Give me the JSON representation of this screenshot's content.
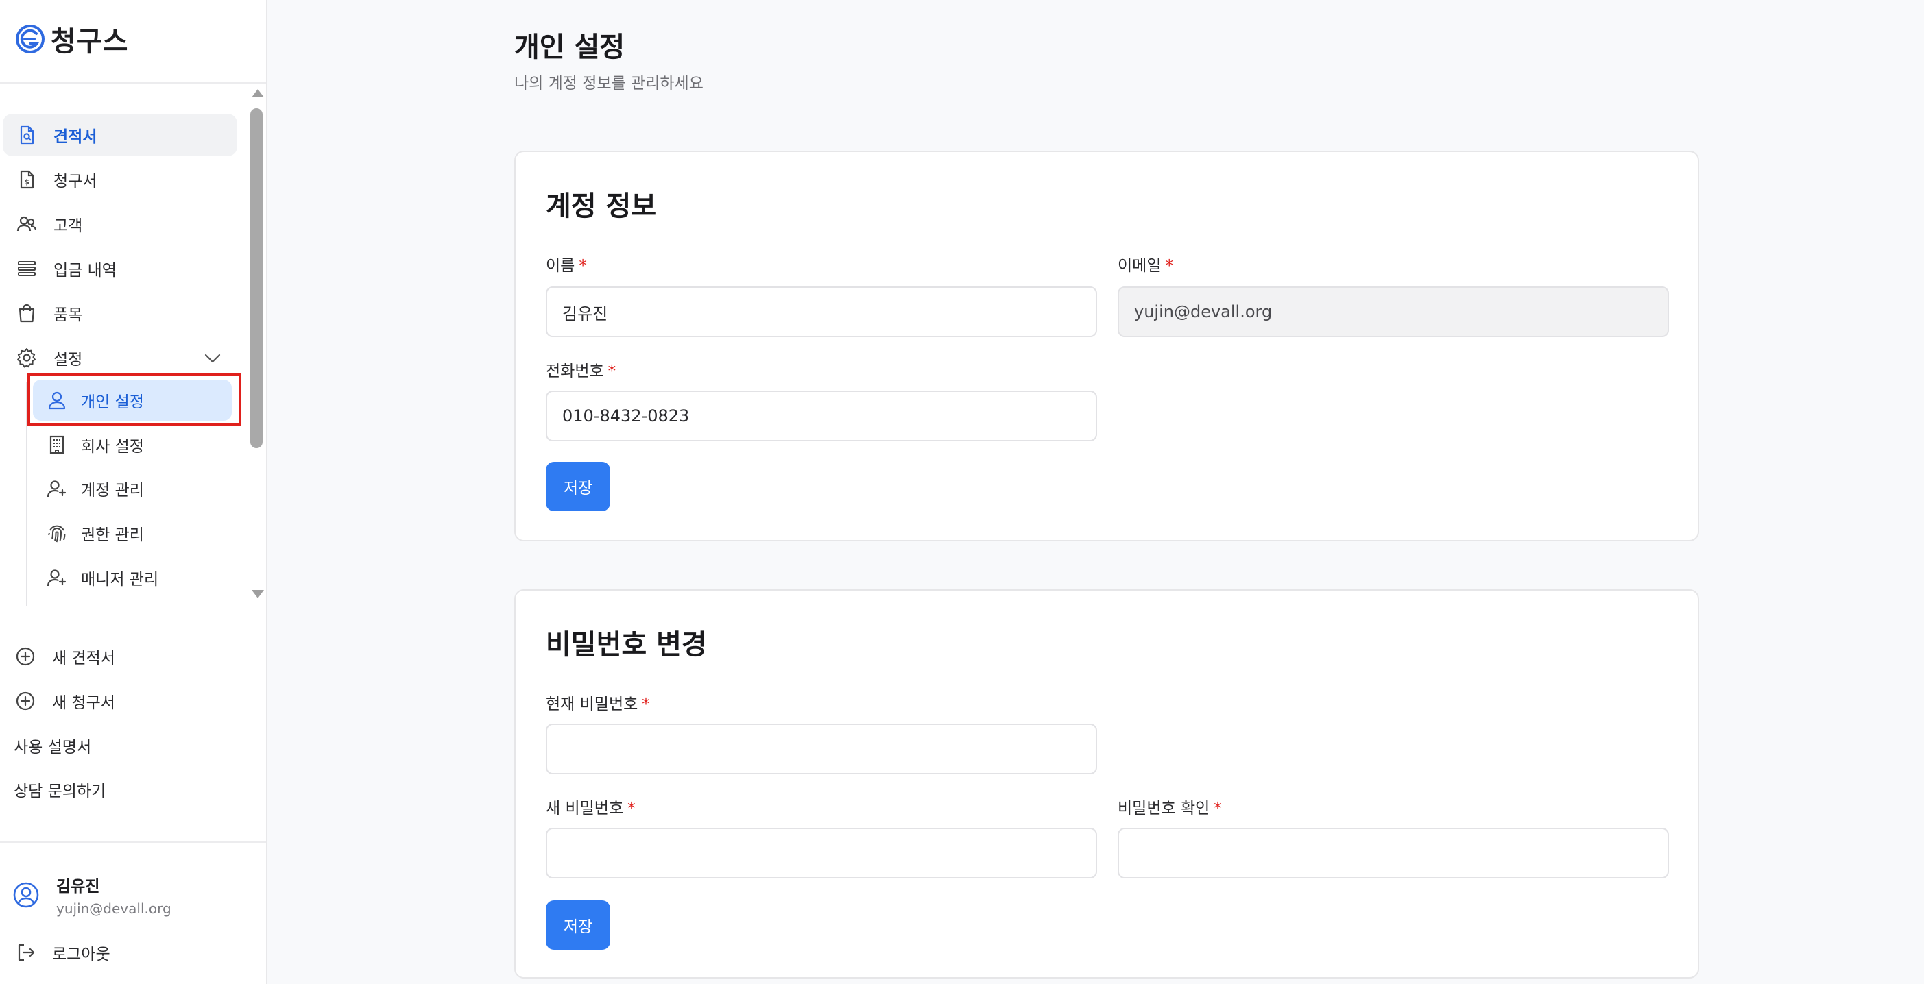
{
  "app": {
    "name": "청구스"
  },
  "sidebar": {
    "nav": [
      {
        "label": "견적서",
        "icon": "quote-doc-icon"
      },
      {
        "label": "청구서",
        "icon": "invoice-doc-icon"
      },
      {
        "label": "고객",
        "icon": "customers-icon"
      },
      {
        "label": "입금 내역",
        "icon": "list-icon"
      },
      {
        "label": "품목",
        "icon": "shopping-bag-icon"
      },
      {
        "label": "설정",
        "icon": "gear-icon"
      }
    ],
    "settings_sub": [
      {
        "label": "개인 설정",
        "icon": "user-icon"
      },
      {
        "label": "회사 설정",
        "icon": "building-icon"
      },
      {
        "label": "계정 관리",
        "icon": "user-plus-icon"
      },
      {
        "label": "권한 관리",
        "icon": "fingerprint-icon"
      },
      {
        "label": "매니저 관리",
        "icon": "user-plus-icon"
      }
    ],
    "actions": [
      {
        "label": "새 견적서",
        "icon": "plus-circle-icon"
      },
      {
        "label": "새 청구서",
        "icon": "plus-circle-icon"
      }
    ],
    "links": [
      {
        "label": "사용 설명서"
      },
      {
        "label": "상담 문의하기"
      }
    ],
    "user": {
      "name": "김유진",
      "email": "yujin@devall.org"
    },
    "logout": "로그아웃"
  },
  "main": {
    "title": "개인 설정",
    "subtitle": "나의 계정 정보를 관리하세요",
    "account_card": {
      "title": "계정 정보",
      "name_label": "이름",
      "name_value": "김유진",
      "email_label": "이메일",
      "email_value": "yujin@devall.org",
      "phone_label": "전화번호",
      "phone_value": "010-8432-0823",
      "required_mark": "*",
      "save_label": "저장"
    },
    "password_card": {
      "title": "비밀번호 변경",
      "current_label": "현재 비밀번호",
      "new_label": "새 비밀번호",
      "confirm_label": "비밀번호 확인",
      "required_mark": "*",
      "save_label": "저장"
    }
  },
  "colors": {
    "accent": "#2f7bf2",
    "active_text": "#1b5fd6",
    "required": "#e0201c",
    "highlight": "#e0201c"
  }
}
